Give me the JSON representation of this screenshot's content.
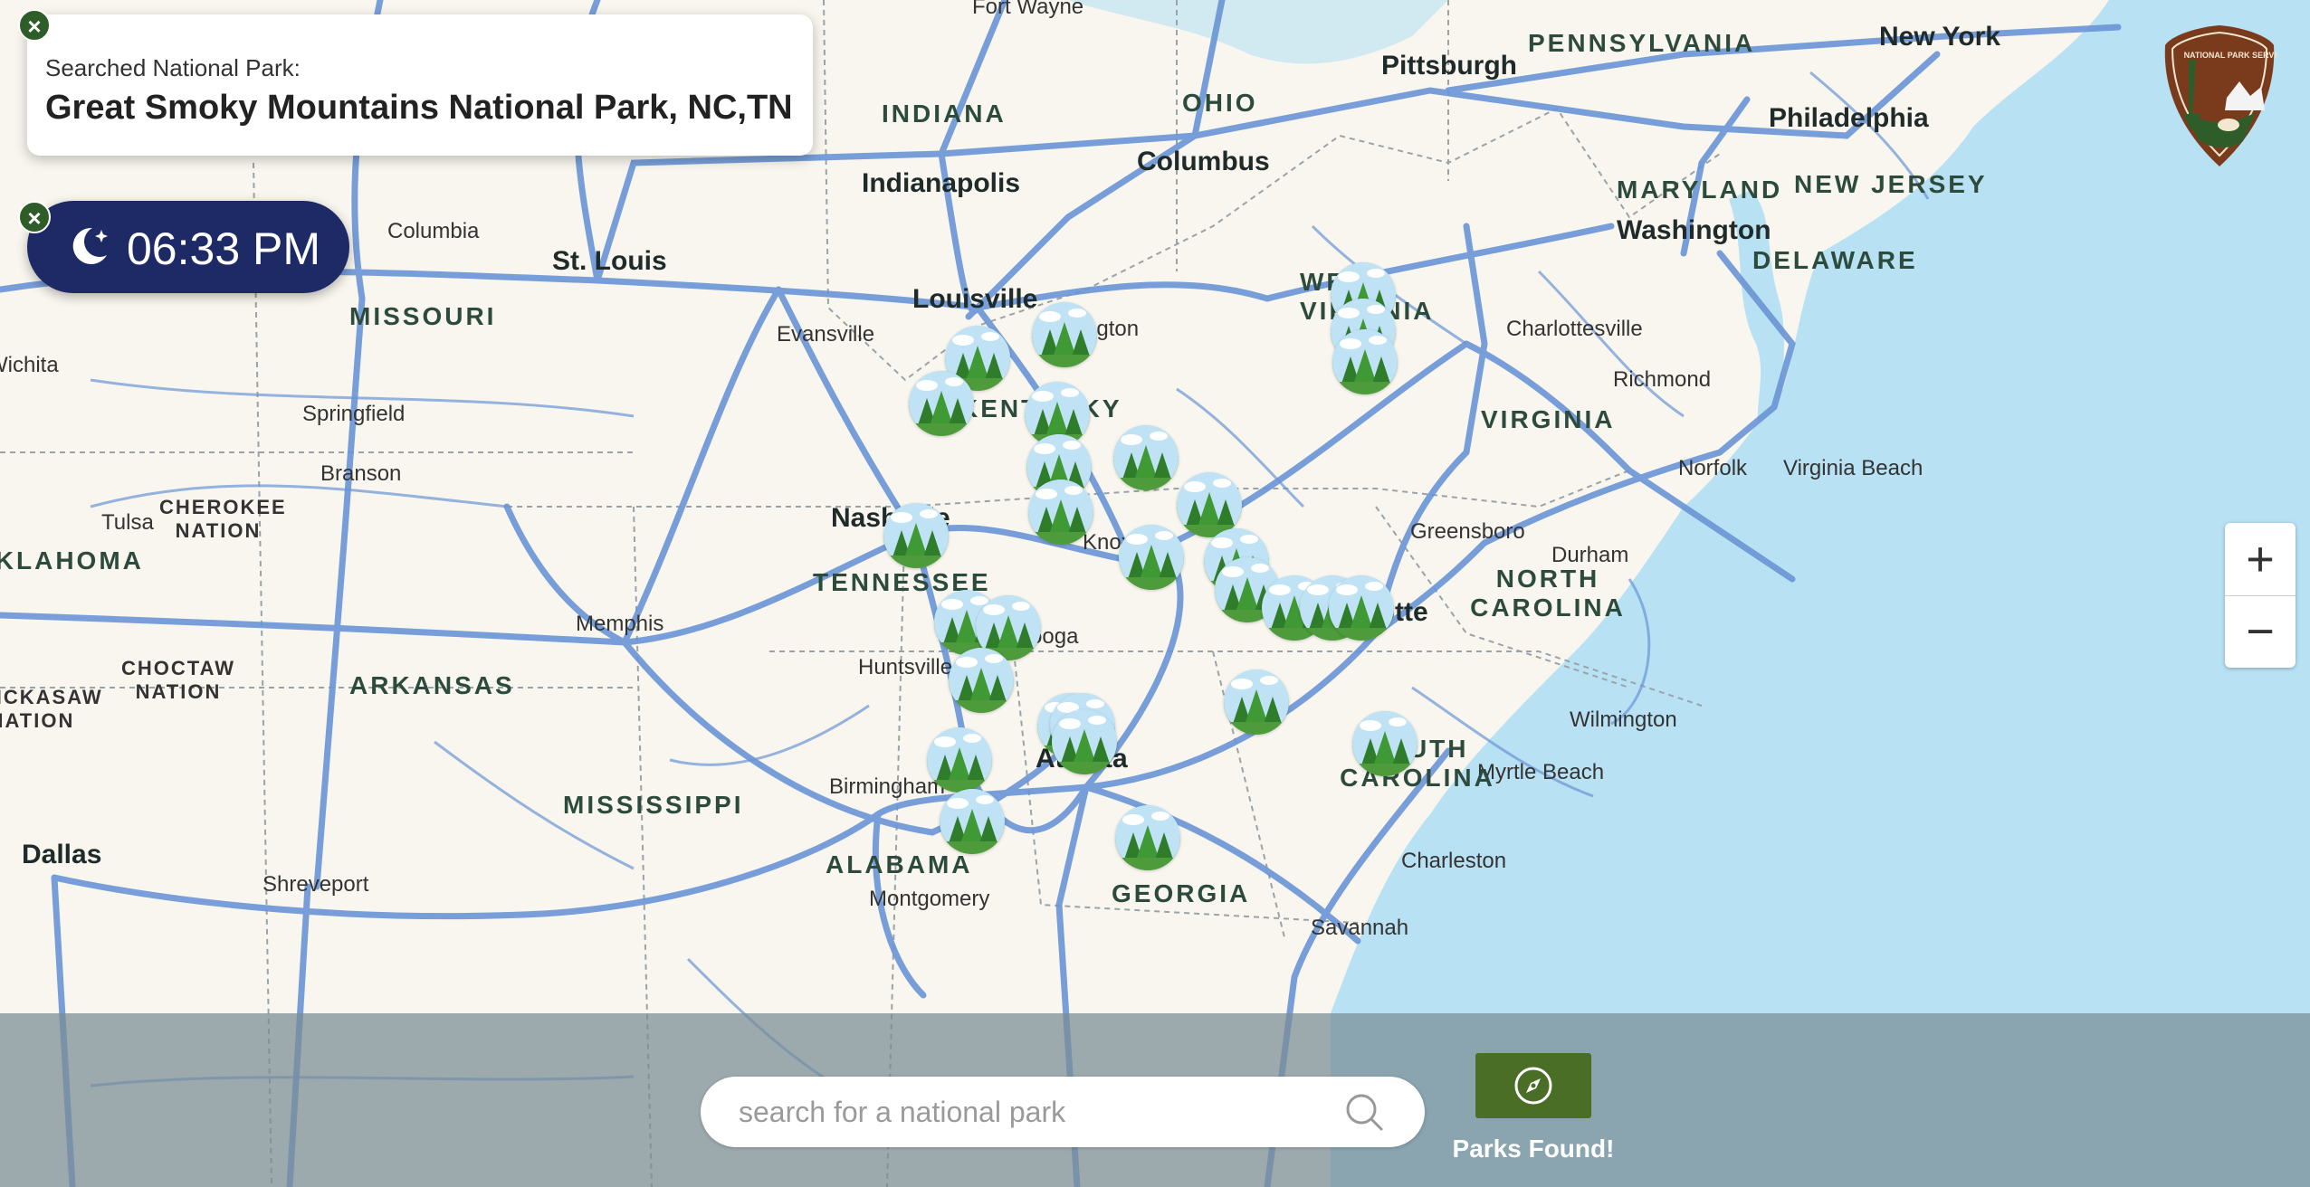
{
  "colors": {
    "land": "#f8f6ee",
    "water": "#b8e1f4",
    "road": "#6a95d6",
    "border": "#9aa3a8",
    "accent_green": "#4a6e26",
    "clock_bg": "#1d2a66"
  },
  "search_result": {
    "label": "Searched National Park:",
    "value": "Great Smoky Mountains National Park, NC,TN",
    "close_icon": "close-icon"
  },
  "clock": {
    "time": "06:33 PM",
    "icon": "moon-stars-icon",
    "close_icon": "close-icon"
  },
  "logo": {
    "text": "NATIONAL PARK SERVICE",
    "icon": "nps-arrowhead-icon"
  },
  "zoom": {
    "in": "+",
    "out": "−"
  },
  "search": {
    "placeholder": "search for a national park",
    "value": "",
    "icon": "search-icon"
  },
  "find_button": {
    "icon": "compass-icon",
    "label": "Parks Found!"
  },
  "map": {
    "state_labels": [
      "INDIANA",
      "OHIO",
      "PENNSYLVANIA",
      "MARYLAND",
      "NEW JERSEY",
      "DELAWARE",
      "MISSOURI",
      "KENTUCKY",
      "WEST VIRGINIA",
      "VIRGINIA",
      "TENNESSEE",
      "NORTH CAROLINA",
      "SOUTH CAROLINA",
      "ARKANSAS",
      "MISSISSIPPI",
      "ALABAMA",
      "GEORGIA",
      "OKLAHOMA"
    ],
    "nation_labels": [
      "CHEROKEE NATION",
      "CHOCTAW NATION",
      "CHICKASAW NATION"
    ],
    "city_labels": [
      "Fort Wayne",
      "Pittsburgh",
      "New York",
      "Philadelphia",
      "Washington",
      "Indianapolis",
      "Columbus",
      "Columbia",
      "St. Louis",
      "Louisville",
      "Lexington",
      "Evansville",
      "Charlottesville",
      "Richmond",
      "Springfield",
      "Branson",
      "Norfolk",
      "Virginia Beach",
      "Tulsa",
      "Nashville",
      "Knoxville",
      "Greensboro",
      "Durham",
      "Memphis",
      "Charlotte",
      "Chattanooga",
      "Huntsville",
      "Wilmington",
      "Atlanta",
      "Birmingham",
      "Myrtle Beach",
      "Dallas",
      "Shreveport",
      "Montgomery",
      "Charleston",
      "Savannah",
      "Wichita"
    ],
    "park_marker_icon": "park-tree-icon",
    "park_marker_count": 26
  }
}
